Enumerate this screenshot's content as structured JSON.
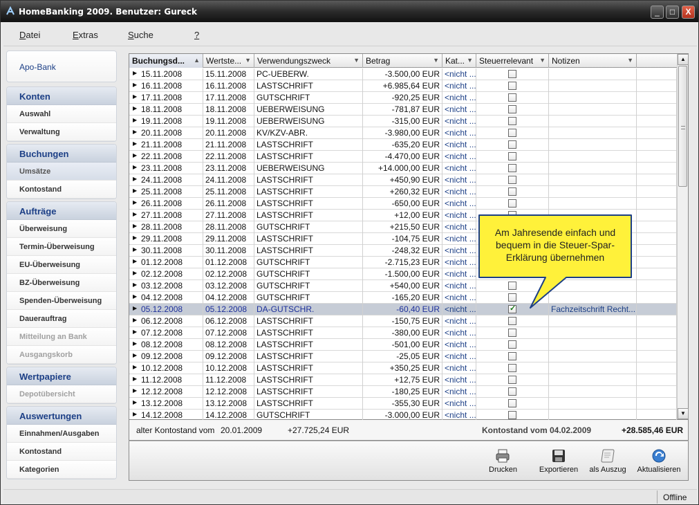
{
  "window": {
    "title": "HomeBanking 2009. Benutzer: Gureck",
    "min": "_",
    "max": "□",
    "close": "X"
  },
  "menu": [
    {
      "key": "D",
      "rest": "atei"
    },
    {
      "key": "E",
      "rest": "xtras"
    },
    {
      "key": "S",
      "rest": "uche"
    },
    {
      "key": "?",
      "rest": ""
    }
  ],
  "sidebar": {
    "bank": "Apo-Bank",
    "groups": [
      {
        "title": "Konten",
        "items": [
          "Auswahl",
          "Verwaltung"
        ]
      },
      {
        "title": "Buchungen",
        "items": [
          "Umsätze",
          "Kontostand"
        ]
      },
      {
        "title": "Aufträge",
        "items": [
          "Überweisung",
          "Termin-Überweisung",
          "EU-Überweisung",
          "BZ-Überweisung",
          "Spenden-Überweisung",
          "Dauerauftrag",
          "Mitteilung an Bank",
          "Ausgangskorb"
        ]
      },
      {
        "title": "Wertpapiere",
        "items": [
          "Depotübersicht"
        ]
      },
      {
        "title": "Auswertungen",
        "items": [
          "Einnahmen/Ausgaben",
          "Kontostand",
          "Kategorien"
        ]
      }
    ]
  },
  "table": {
    "columns": [
      "Buchungsd...",
      "Wertste...",
      "Verwendungszweck",
      "Betrag",
      "Kat...",
      "Steuerrelevant",
      "Notizen"
    ],
    "rows": [
      [
        "15.11.2008",
        "15.11.2008",
        "PC-UEBERW.",
        "-3.500,00 EUR",
        "<nicht ...",
        false,
        ""
      ],
      [
        "16.11.2008",
        "16.11.2008",
        "LASTSCHRIFT",
        "+6.985,64 EUR",
        "<nicht ...",
        false,
        ""
      ],
      [
        "17.11.2008",
        "17.11.2008",
        "GUTSCHRIFT",
        "-920,25 EUR",
        "<nicht ...",
        false,
        ""
      ],
      [
        "18.11.2008",
        "18.11.2008",
        "UEBERWEISUNG",
        "-781,87 EUR",
        "<nicht ...",
        false,
        ""
      ],
      [
        "19.11.2008",
        "19.11.2008",
        "UEBERWEISUNG",
        "-315,00 EUR",
        "<nicht ...",
        false,
        ""
      ],
      [
        "20.11.2008",
        "20.11.2008",
        "KV/KZV-ABR.",
        "-3.980,00 EUR",
        "<nicht ...",
        false,
        ""
      ],
      [
        "21.11.2008",
        "21.11.2008",
        "LASTSCHRIFT",
        "-635,20 EUR",
        "<nicht ...",
        false,
        ""
      ],
      [
        "22.11.2008",
        "22.11.2008",
        "LASTSCHRIFT",
        "-4.470,00 EUR",
        "<nicht ...",
        false,
        ""
      ],
      [
        "23.11.2008",
        "23.11.2008",
        "UEBERWEISUNG",
        "+14.000,00 EUR",
        "<nicht ...",
        false,
        ""
      ],
      [
        "24.11.2008",
        "24.11.2008",
        "LASTSCHRIFT",
        "+450,90 EUR",
        "<nicht ...",
        false,
        ""
      ],
      [
        "25.11.2008",
        "25.11.2008",
        "LASTSCHRIFT",
        "+260,32 EUR",
        "<nicht ...",
        false,
        ""
      ],
      [
        "26.11.2008",
        "26.11.2008",
        "LASTSCHRIFT",
        "-650,00 EUR",
        "<nicht ...",
        false,
        ""
      ],
      [
        "27.11.2008",
        "27.11.2008",
        "LASTSCHRIFT",
        "+12,00 EUR",
        "<nicht ...",
        false,
        ""
      ],
      [
        "28.11.2008",
        "28.11.2008",
        "GUTSCHRIFT",
        "+215,50 EUR",
        "<nicht ...",
        false,
        ""
      ],
      [
        "29.11.2008",
        "29.11.2008",
        "LASTSCHRIFT",
        "-104,75 EUR",
        "<nicht ...",
        false,
        ""
      ],
      [
        "30.11.2008",
        "30.11.2008",
        "LASTSCHRIFT",
        "-248,32 EUR",
        "<nicht ...",
        false,
        ""
      ],
      [
        "01.12.2008",
        "01.12.2008",
        "GUTSCHRIFT",
        "-2.715,23 EUR",
        "<nicht ...",
        false,
        ""
      ],
      [
        "02.12.2008",
        "02.12.2008",
        "GUTSCHRIFT",
        "-1.500,00 EUR",
        "<nicht ...",
        false,
        ""
      ],
      [
        "03.12.2008",
        "03.12.2008",
        "GUTSCHRIFT",
        "+540,00 EUR",
        "<nicht ...",
        false,
        ""
      ],
      [
        "04.12.2008",
        "04.12.2008",
        "GUTSCHRIFT",
        "-165,20 EUR",
        "<nicht ...",
        false,
        ""
      ],
      [
        "05.12.2008",
        "05.12.2008",
        "DA-GUTSCHR.",
        "-60,40 EUR",
        "<nicht ...",
        true,
        "Fachzeitschrift Recht..."
      ],
      [
        "06.12.2008",
        "06.12.2008",
        "LASTSCHRIFT",
        "-150,75 EUR",
        "<nicht ...",
        false,
        ""
      ],
      [
        "07.12.2008",
        "07.12.2008",
        "LASTSCHRIFT",
        "-380,00 EUR",
        "<nicht ...",
        false,
        ""
      ],
      [
        "08.12.2008",
        "08.12.2008",
        "LASTSCHRIFT",
        "-501,00 EUR",
        "<nicht ...",
        false,
        ""
      ],
      [
        "09.12.2008",
        "09.12.2008",
        "LASTSCHRIFT",
        "-25,05 EUR",
        "<nicht ...",
        false,
        ""
      ],
      [
        "10.12.2008",
        "10.12.2008",
        "LASTSCHRIFT",
        "+350,25 EUR",
        "<nicht ...",
        false,
        ""
      ],
      [
        "11.12.2008",
        "11.12.2008",
        "LASTSCHRIFT",
        "+12,75 EUR",
        "<nicht ...",
        false,
        ""
      ],
      [
        "12.12.2008",
        "12.12.2008",
        "LASTSCHRIFT",
        "-180,25 EUR",
        "<nicht ...",
        false,
        ""
      ],
      [
        "13.12.2008",
        "13.12.2008",
        "LASTSCHRIFT",
        "-355,30 EUR",
        "<nicht ...",
        false,
        ""
      ],
      [
        "14.12.2008",
        "14.12.2008",
        "GUTSCHRIFT",
        "-3.000,00 EUR",
        "<nicht ...",
        false,
        ""
      ]
    ],
    "selected_row": "05.12.2008"
  },
  "summary": {
    "old_label": "alter Kontostand vom",
    "old_date": "20.01.2009",
    "old_amount": "+27.725,24 EUR",
    "new_label": "Kontostand vom 04.02.2009",
    "new_amount": "+28.585,46 EUR"
  },
  "toolbar": {
    "print": "Drucken",
    "export": "Exportieren",
    "statement": "als Auszug",
    "refresh": "Aktualisieren"
  },
  "callout": "Am Jahresende einfach und bequem in die Steuer-Spar-Erklärung übernehmen",
  "status": "Offline"
}
